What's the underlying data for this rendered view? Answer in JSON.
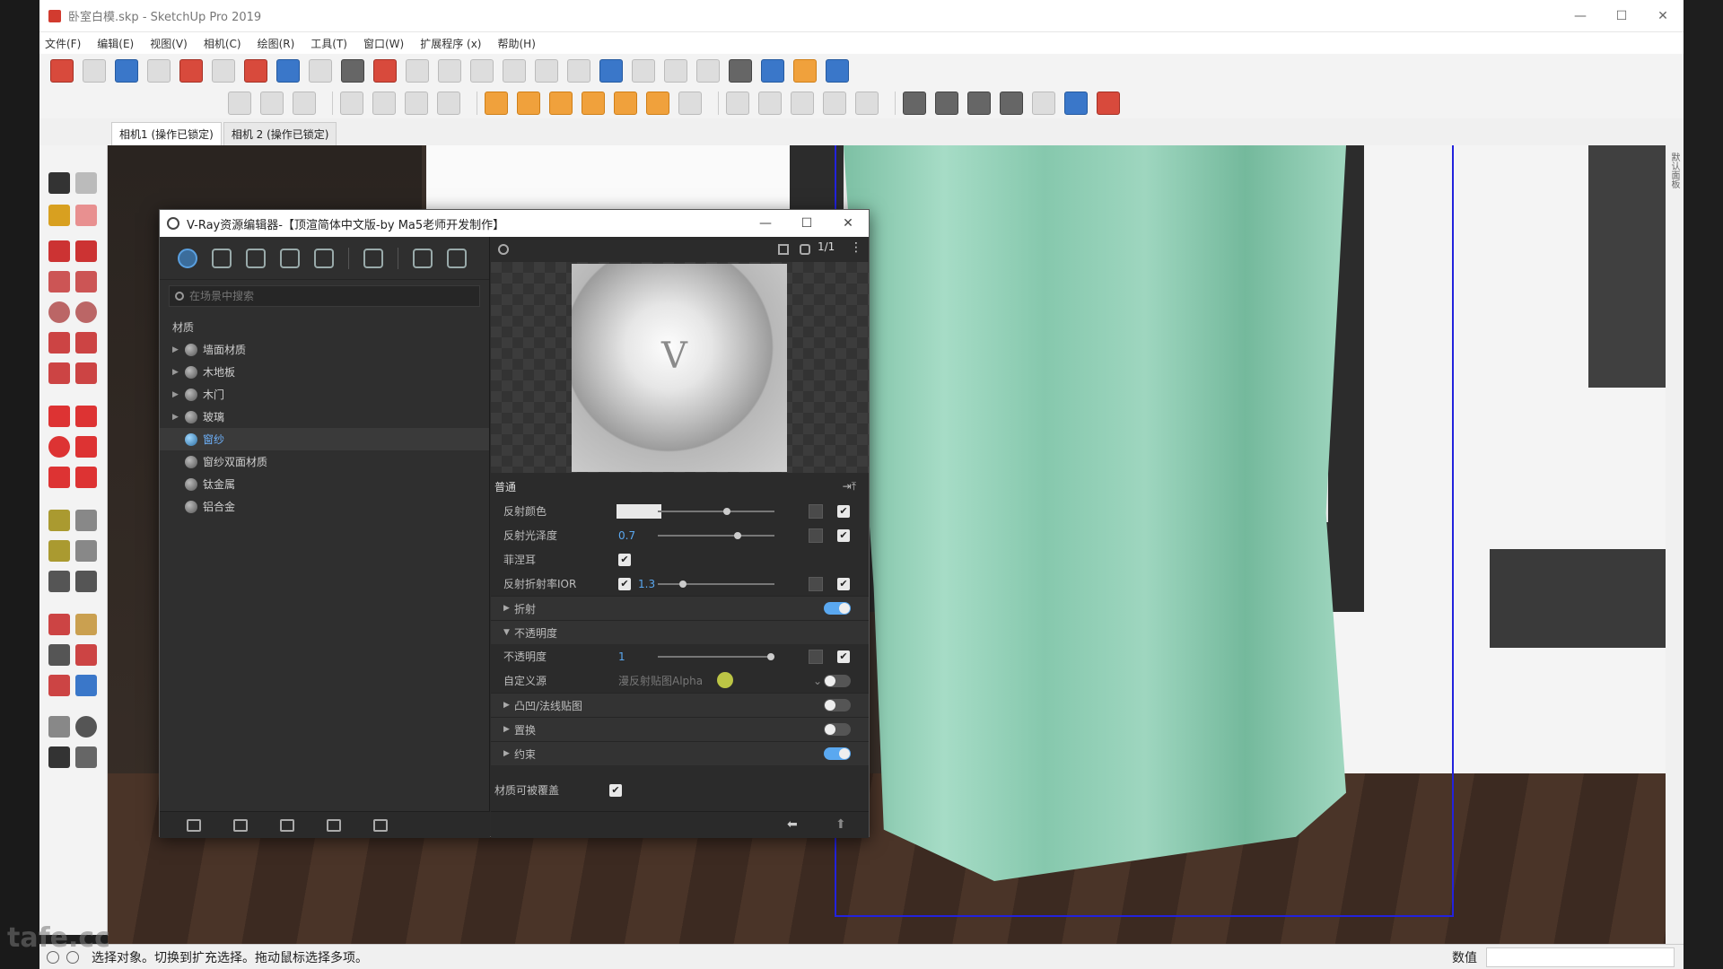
{
  "window": {
    "title": "卧室白模.skp - SketchUp Pro 2019",
    "controls": [
      "—",
      "☐",
      "✕"
    ]
  },
  "menu": [
    "文件(F)",
    "编辑(E)",
    "视图(V)",
    "相机(C)",
    "绘图(R)",
    "工具(T)",
    "窗口(W)",
    "扩展程序 (x)",
    "帮助(H)"
  ],
  "scene_tabs": [
    "相机1 (操作已锁定)",
    "相机 2 (操作已锁定)"
  ],
  "right_panel_label": "默认面板",
  "status": {
    "message": "选择对象。切换到扩充选择。拖动鼠标选择多项。",
    "measure_label": "数值",
    "measure_value": ""
  },
  "watermark": "tafe.cc",
  "vray": {
    "title": "V-Ray资源编辑器-【顶渲简体中文版-by Ma5老师开发制作】",
    "search_placeholder": "在场景中搜索",
    "section": "材质",
    "materials": [
      {
        "name": "墙面材质",
        "expandable": true
      },
      {
        "name": "木地板",
        "expandable": true
      },
      {
        "name": "木门",
        "expandable": true
      },
      {
        "name": "玻璃",
        "expandable": true
      },
      {
        "name": "窗纱",
        "expandable": false,
        "selected": true
      },
      {
        "name": "窗纱双面材质",
        "expandable": false
      },
      {
        "name": "钛金属",
        "expandable": false
      },
      {
        "name": "铝合金",
        "expandable": false
      }
    ],
    "preview_size": "1/1",
    "props": {
      "header": "普通",
      "reflect_color_label": "反射颜色",
      "reflect_color": "#e8e8e8",
      "reflect_gloss_label": "反射光泽度",
      "reflect_gloss_value": "0.7",
      "fresnel_label": "菲涅耳",
      "fresnel_ior_label": "反射折射率IOR",
      "fresnel_ior_value": "1.3",
      "refraction_label": "折射",
      "opacity_group_label": "不透明度",
      "opacity_label": "不透明度",
      "opacity_value": "1",
      "custom_source_label": "自定义源",
      "custom_source_value": "漫反射贴图Alpha",
      "bump_label": "凸凹/法线贴图",
      "displacement_label": "置换",
      "binding_label": "约束",
      "override_label": "材质可被覆盖"
    },
    "slider_levels": {
      "reflect_color": 0.6,
      "reflect_gloss": 0.7,
      "fresnel_ior": 0.2,
      "opacity": 1.0
    }
  },
  "colors": {
    "accent": "#5aa8f0",
    "curtain": "#8fcfb4",
    "bbox": "#2222dd"
  }
}
